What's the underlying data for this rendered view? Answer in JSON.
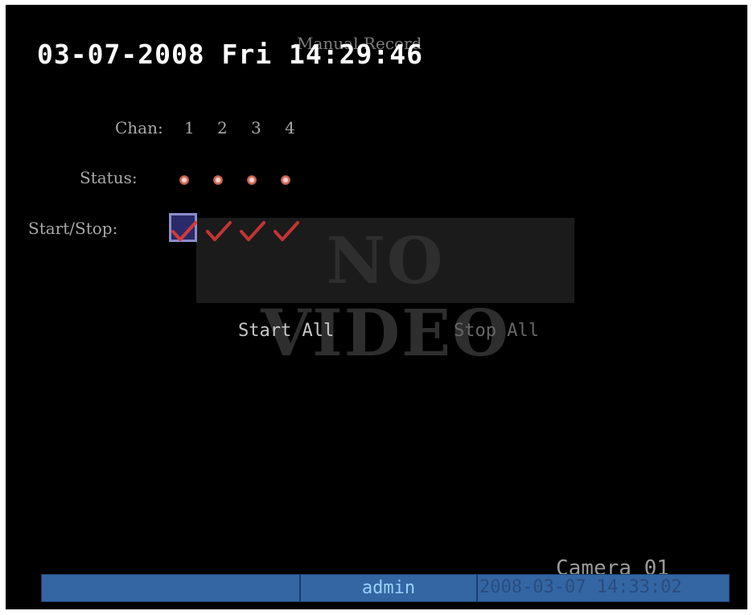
{
  "overlay": {
    "datetime": "03-07-2008 Fri 14:29:46",
    "no_video": "NO VIDEO",
    "camera_name": "Camera 01"
  },
  "menu": {
    "title": "Manual Record",
    "chan_label": "Chan:",
    "channels": [
      "1",
      "2",
      "3",
      "4"
    ],
    "status_label": "Status:",
    "status": [
      "not-recording-icon",
      "not-recording-icon",
      "not-recording-icon",
      "not-recording-icon"
    ],
    "startstop_label": "Start/Stop:",
    "start_stop": [
      "check-icon",
      "check-icon",
      "check-icon",
      "check-icon"
    ],
    "start_all": "Start All",
    "stop_all": "Stop All"
  },
  "status_bar": {
    "user": "admin",
    "datetime": "2008-03-07 14:33:02"
  },
  "colors": {
    "screen_bg": "#000000",
    "bar_bg": "#3366a3",
    "check": "#d33a3a",
    "focus_border": "#8c8cc8"
  }
}
